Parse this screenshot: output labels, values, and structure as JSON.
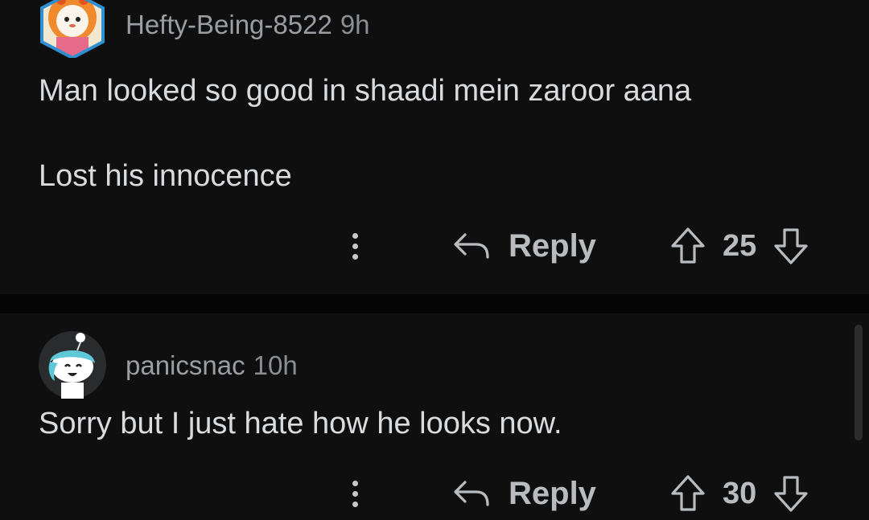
{
  "comments": [
    {
      "username": "Hefty-Being-8522",
      "age": "9h",
      "body_line_1": "Man looked so good in shaadi mein zaroor aana",
      "body_line_2": "Lost his innocence",
      "reply_label": "Reply",
      "score": "25",
      "avatar_icon": "lion-costume-avatar-icon"
    },
    {
      "username": "panicsnac",
      "age": "10h",
      "body_line_1": "Sorry but I just hate how he looks now.",
      "reply_label": "Reply",
      "score": "30",
      "avatar_icon": "snoo-avatar-icon"
    }
  ],
  "colors": {
    "background": "#0f0f10",
    "divider": "#050506",
    "text": "#d9dbdd",
    "meta": "#8b8e92",
    "icon": "#b9bcbf"
  }
}
